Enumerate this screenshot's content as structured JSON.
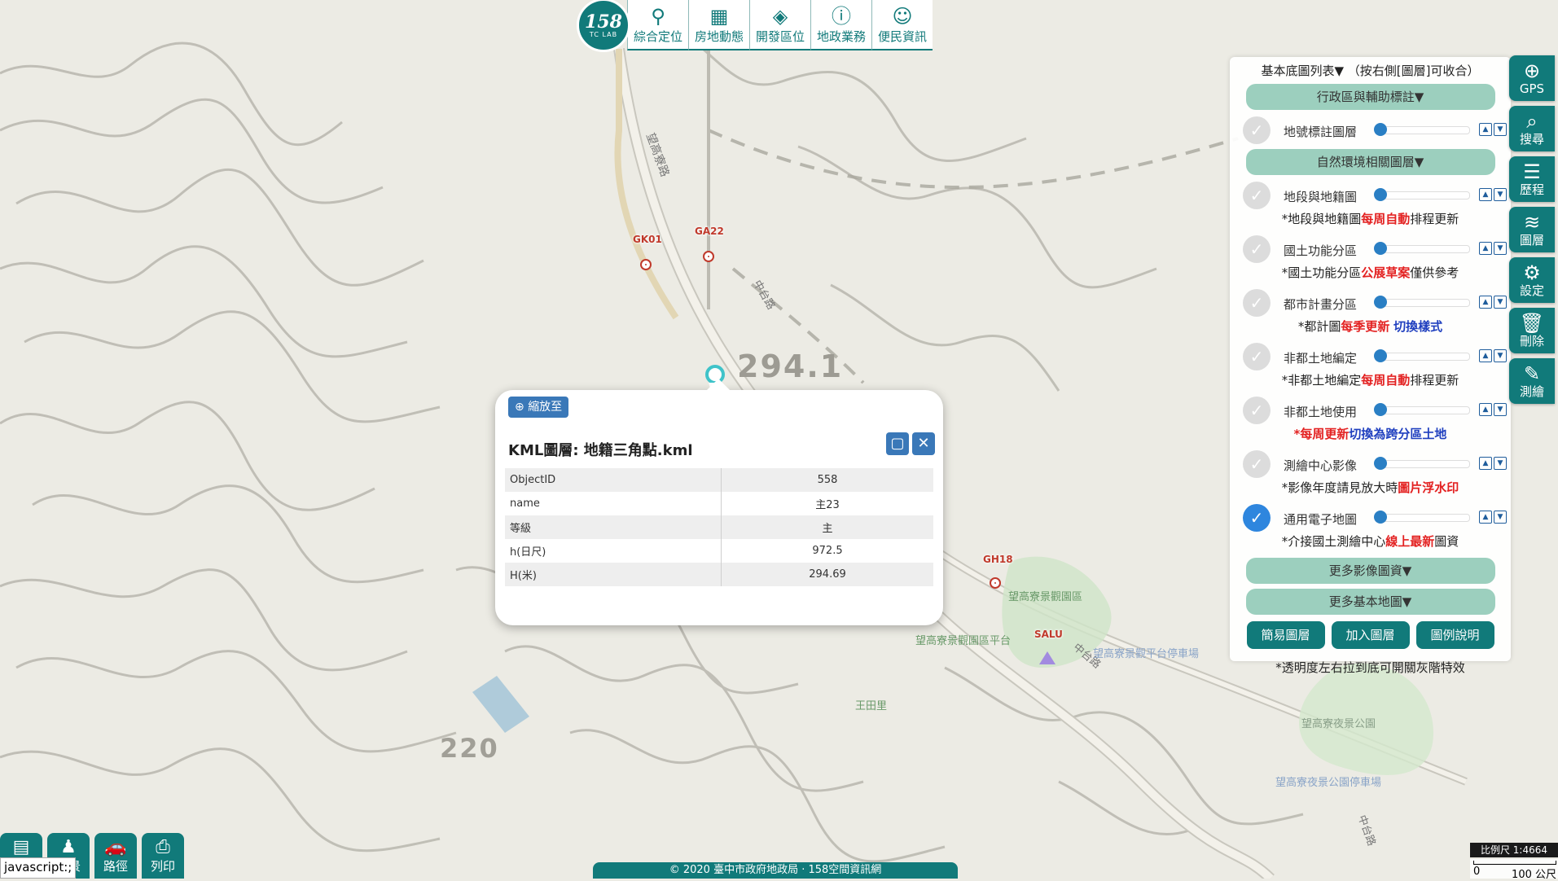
{
  "topnav": {
    "logo_number": "158",
    "logo_sub": "TC LAB",
    "items": [
      {
        "label": "綜合定位",
        "icon": "location-pin-icon",
        "glyph": "⚲"
      },
      {
        "label": "房地動態",
        "icon": "building-icon",
        "glyph": "▦"
      },
      {
        "label": "開發區位",
        "icon": "layers-icon",
        "glyph": "◈"
      },
      {
        "label": "地政業務",
        "icon": "info-icon",
        "glyph": "ⓘ"
      },
      {
        "label": "便民資訊",
        "icon": "user-icon",
        "glyph": "☺"
      }
    ]
  },
  "tools": [
    {
      "label": "GPS",
      "icon": "gps-icon",
      "glyph": "⊕"
    },
    {
      "label": "搜尋",
      "icon": "search-icon",
      "glyph": "⌕"
    },
    {
      "label": "歷程",
      "icon": "history-icon",
      "glyph": "☰"
    },
    {
      "label": "圖層",
      "icon": "layers-icon",
      "glyph": "≋"
    },
    {
      "label": "設定",
      "icon": "gear-icon",
      "glyph": "⚙"
    },
    {
      "label": "刪除",
      "icon": "trash-icon",
      "glyph": "🗑"
    },
    {
      "label": "測繪",
      "icon": "edit-icon",
      "glyph": "✎"
    }
  ],
  "panel": {
    "title": "基本底圖列表▼ （按右側[圖層]可收合）",
    "group1": "行政區與輔助標註▼",
    "group2": "自然環境相關圖層▼",
    "layers": [
      {
        "name": "地號標註圖層",
        "checked": false
      },
      {
        "name": "地段與地籍圖",
        "checked": false
      },
      {
        "name": "國土功能分區",
        "checked": false
      },
      {
        "name": "都市計畫分區",
        "checked": false
      },
      {
        "name": "非都土地編定",
        "checked": false
      },
      {
        "name": "非都土地使用",
        "checked": false
      },
      {
        "name": "測繪中心影像",
        "checked": false
      },
      {
        "name": "通用電子地圖",
        "checked": true
      }
    ],
    "notes": {
      "n1a": "*地段與地籍圖",
      "n1b": "每周自動",
      "n1c": "排程更新",
      "n2a": "*國土功能分區",
      "n2b": "公展草案",
      "n2c": "僅供參考",
      "n3a": "*都計圖",
      "n3b": "每季更新",
      "n3c": "切換樣式",
      "n4a": "*非都土地編定",
      "n4b": "每周自動",
      "n4c": "排程更新",
      "n5a": "*",
      "n5b": "每周更新",
      "n5c": "切換為跨分區土地",
      "n6a": "*影像年度請見放大時",
      "n6b": "圖片浮水印",
      "n7a": "*介接國土測繪中心",
      "n7b": "線上最新",
      "n7c": "圖資"
    },
    "more_imagery": "更多影像圖資▼",
    "more_basemap": "更多基本地圖▼",
    "buttons": [
      "簡易圖層",
      "加入圖層",
      "圖例說明"
    ],
    "footer": "*透明度左右拉到底可開關灰階特效"
  },
  "popup": {
    "zoom_label": "縮放至",
    "title": "KML圖層: 地籍三角點.kml",
    "rows": [
      {
        "k": "ObjectID",
        "v": "558"
      },
      {
        "k": "name",
        "v": "主23"
      },
      {
        "k": "等級",
        "v": "主"
      },
      {
        "k": "h(日尺)",
        "v": "972.5"
      },
      {
        "k": "H(米)",
        "v": "294.69"
      }
    ]
  },
  "map": {
    "markers": [
      {
        "label": "GK01"
      },
      {
        "label": "GA22"
      },
      {
        "label": "GH18"
      },
      {
        "label": "SALU"
      }
    ],
    "elevation": "294.1",
    "elevation2": "220",
    "road_vertical": "望高寮路",
    "road_zhong": "中台路",
    "road_zhong2": "中台路",
    "road_bottom": "中台路",
    "poi": {
      "park": "望高寮景觀園區",
      "platform": "望高寮景觀園區平台",
      "parking": "望高寮景觀平台停車場",
      "wangtian": "王田里",
      "nightpark": "望高寮夜景公園",
      "nightparking": "望高寮夜景公園停車場"
    }
  },
  "bottom_tools": [
    {
      "label": "分析",
      "icon": "analysis-icon",
      "glyph": "▤"
    },
    {
      "label": "街景",
      "icon": "streetview-person-icon",
      "glyph": "♟"
    },
    {
      "label": "路徑",
      "icon": "car-route-icon",
      "glyph": "🚗"
    },
    {
      "label": "列印",
      "icon": "printer-icon",
      "glyph": "⎙"
    }
  ],
  "status": "javascript:;",
  "copyright": "© 2020 臺中市政府地政局 · 158空間資訊網",
  "scale": {
    "label": "比例尺 1:4664",
    "left": "0",
    "right": "100 公尺"
  }
}
